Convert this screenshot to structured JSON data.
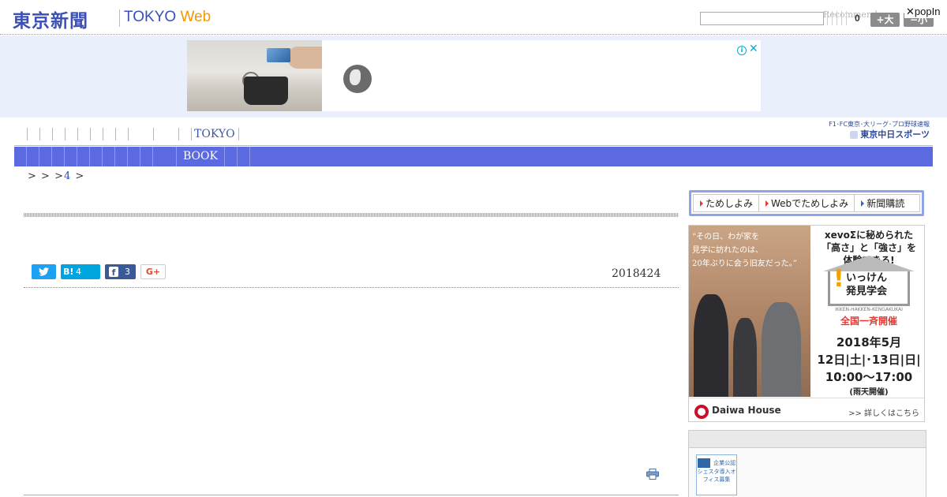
{
  "header": {
    "logo_jp": "東京新聞",
    "logo_tokyo": "TOKYO",
    "logo_web": "Web",
    "search_placeholder": "",
    "recommend_text": "Recommend",
    "counter_value": "0",
    "size_up_label": "+大",
    "size_down_label": "−小",
    "popin_label": "✕popIn"
  },
  "ad_banner": {
    "info_icon": "info-icon",
    "close_icon": "close-icon"
  },
  "nav": {
    "primary_label": "TOKYO",
    "secondary_label": "BOOK",
    "chunichi_top": "F1･FC東京･大リーグ･プロ野球速報",
    "chunichi_bottom": "東京中日スポーツ"
  },
  "breadcrumb": {
    "part1": ">",
    "part2": ">",
    "part3": ">",
    "num": "4",
    "part4": ">"
  },
  "article": {
    "date": "2018424",
    "share": {
      "hatena_label": "B!",
      "hatena_count": "4",
      "facebook_count": "3",
      "google_label": "G+"
    }
  },
  "sidebar": {
    "tameshi": [
      {
        "label": "ためしよみ"
      },
      {
        "label": "Webでためしよみ"
      },
      {
        "label": "新聞購読"
      }
    ],
    "daiwa_ad": {
      "copy_line1": "“その日、わが家を",
      "copy_line2": "見学に訪れたのは、",
      "copy_line3": "20年ぶりに会う旧友だった。”",
      "lead_line1": "xevoΣに秘められた",
      "lead_line2": "「高さ」と「強さ」を",
      "lead_line3": "体験できる!",
      "event_name_1": "いっけん",
      "event_name_2": "発見学会",
      "event_en": "IKKEN-HAKKEN-KENGAKUKAI",
      "event_cat": "全国一斉開催",
      "event_date": "2018年5月",
      "event_days": "12日|土|･13日|日|",
      "event_time": "10:00〜17:00",
      "event_note": "(雨天開催)",
      "brand": "Daiwa House",
      "more": ">> 詳しくはこちら"
    },
    "panel_badge": "企業公認シェスタ導入オフィス募集"
  },
  "colors": {
    "brand_blue": "#3b4fb4",
    "nav_bar": "#5b6ae0",
    "web_orange": "#f39800",
    "ad_band": "#eaf0fb"
  }
}
